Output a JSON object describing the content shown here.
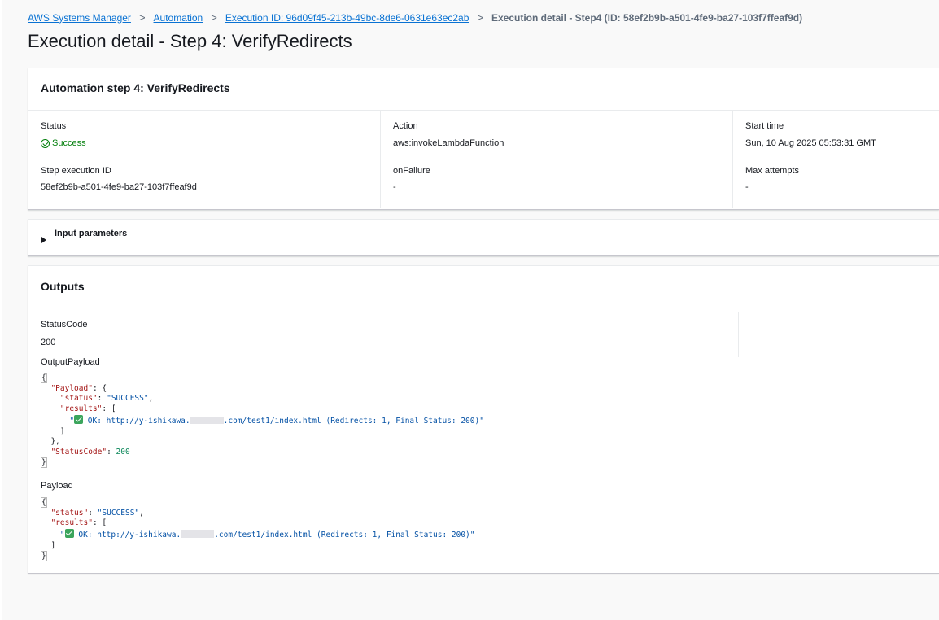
{
  "breadcrumb": {
    "items": [
      "AWS Systems Manager",
      "Automation",
      "Execution ID: 96d09f45-213b-49bc-8de6-0631e63ec2ab"
    ],
    "current": "Execution detail - Step4 (ID: 58ef2b9b-a501-4fe9-ba27-103f7ffeaf9d)",
    "separator": ">"
  },
  "page_title": "Execution detail - Step 4: VerifyRedirects",
  "step_panel": {
    "title": "Automation step 4: VerifyRedirects",
    "status_label": "Status",
    "status_value": "Success",
    "action_label": "Action",
    "action_value": "aws:invokeLambdaFunction",
    "start_time_label": "Start time",
    "start_time_value": "Sun, 10 Aug 2025 05:53:31 GMT",
    "step_execution_id_label": "Step execution ID",
    "step_execution_id_value": "58ef2b9b-a501-4fe9-ba27-103f7ffeaf9d",
    "on_failure_label": "onFailure",
    "on_failure_value": "-",
    "max_attempts_label": "Max attempts",
    "max_attempts_value": "-"
  },
  "input_parameters": {
    "title": "Input parameters",
    "expanded": false
  },
  "outputs": {
    "title": "Outputs",
    "status_code_label": "StatusCode",
    "status_code_value": "200",
    "output_payload_label": "OutputPayload",
    "payload_label": "Payload",
    "json": {
      "payload_key": "\"Payload\"",
      "status_key": "\"status\"",
      "status_value": "\"SUCCESS\"",
      "results_key": "\"results\"",
      "result_prefix": "OK: http://y-ishikawa.",
      "result_suffix": ".com/test1/index.html (Redirects: 1, Final Status: 200)\"",
      "status_code_key": "\"StatusCode\"",
      "status_code_value": "200"
    }
  },
  "colors": {
    "link": "#0972d3",
    "success": "#037f0c",
    "json_key": "#a31515",
    "json_string": "#0451a5",
    "json_number": "#098658"
  },
  "icons": [
    "chevron-right-icon",
    "status-success-icon",
    "caret-right-icon",
    "check-mark-emoji-icon"
  ]
}
